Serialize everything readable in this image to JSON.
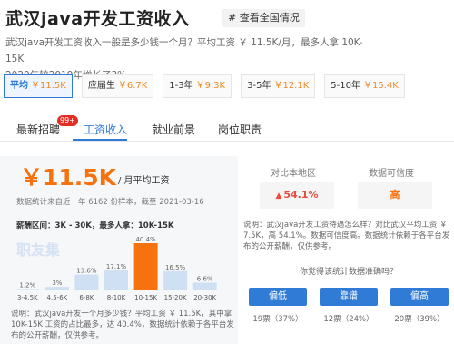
{
  "header": {
    "title": "武汉java开发工资收入",
    "nation_link": "# 查看全国情况",
    "desc_line1": "武汉java开发工资收入一般是多少钱一个月？平均工资 ￥ 11.5K/月，最多人拿 10K-15K",
    "desc_line2": "2020年较2019年增长了3%"
  },
  "tiers": [
    {
      "label": "平均",
      "value": "￥11.5K",
      "active": true
    },
    {
      "label": "应届生",
      "value": "￥6.7K",
      "active": false
    },
    {
      "label": "1-3年",
      "value": "￥9.3K",
      "active": false
    },
    {
      "label": "3-5年",
      "value": "￥12.1K",
      "active": false
    },
    {
      "label": "5-10年",
      "value": "￥15.4K",
      "active": false
    }
  ],
  "tabs": [
    {
      "label": "最新招聘",
      "active": false
    },
    {
      "label": "工资收入",
      "active": true
    },
    {
      "label": "就业前景",
      "active": false
    },
    {
      "label": "岗位职责",
      "active": false
    }
  ],
  "badge": "99+",
  "salary": {
    "amount": "￥11.5K",
    "unit": "/ 月平均工资",
    "stats": "数据统计来自近一年 6162 份样本，截至 2021-03-16",
    "range_label": "薪酬区间：3K - 30K，最多人拿：10K-15K",
    "watermark": "职友集"
  },
  "chart_data": {
    "type": "bar",
    "categories": [
      "3-4.5K",
      "4.5-6K",
      "6-8K",
      "8-10K",
      "10-15K",
      "15-20K",
      "20-30K"
    ],
    "values": [
      1.2,
      3,
      13.6,
      17.1,
      40.4,
      16.5,
      6.6
    ],
    "value_labels": [
      "1.2%",
      "3%",
      "13.6%",
      "17.1%",
      "40.4%",
      "16.5%",
      "6.6%"
    ],
    "highlight_index": 4,
    "colors": {
      "bar": "#cfe0f5",
      "highlight": "#f5720f"
    },
    "title": "",
    "xlabel": "",
    "ylabel": ""
  },
  "left_note": "说明：武汉java开发一个月多少钱？平均工资 ￥ 11.5K，其中拿 10K-15K 工资的占比最多，达 40.4%，数据统计依赖于各平台发布的公开薪酬，仅供参考。",
  "right": {
    "head_compare": "对比本地区",
    "head_credibility": "数据可信度",
    "compare_value": "54.1%",
    "credibility_value": "高",
    "note": "说明：武汉java开发工资待遇怎么样？对比武汉平均工资 ￥ 7.5K，高 54.1%。数据可信度高。数据统计依赖于各平台发布的公开薪酬，仅供参考。",
    "question": "你觉得该统计数据准确吗？",
    "votes": [
      {
        "label": "偏低",
        "count": "19票（37%）"
      },
      {
        "label": "靠谱",
        "count": "12票（24%）"
      },
      {
        "label": "偏高",
        "count": "20票（39%）"
      }
    ]
  },
  "colors": {
    "accent": "#2f7bd6",
    "orange": "#f5720f",
    "red": "#e74c3c"
  }
}
